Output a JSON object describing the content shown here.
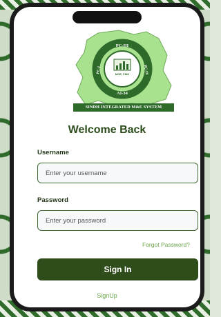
{
  "logo": {
    "ring_top_text": "PC-III",
    "ring_left_text": "PC-I",
    "ring_right_text": "PC-IV",
    "ring_bottom_text": "AI-34",
    "center_text": "MGE, PMO",
    "caption": "SINDH INTEGRATED M&E SYSTEM"
  },
  "title": "Welcome Back",
  "form": {
    "username_label": "Username",
    "username_placeholder": "Enter your username",
    "password_label": "Password",
    "password_placeholder": "Enter your password",
    "forgot_link": "Forgot Password?",
    "signin_button": "Sign In",
    "signup_link": "SignUp"
  },
  "colors": {
    "brand_dark": "#2f4d1b",
    "brand_light": "#6aa64a",
    "map_green": "#a8e28f"
  },
  "icons": {
    "logo": "sindh-map-logo"
  }
}
